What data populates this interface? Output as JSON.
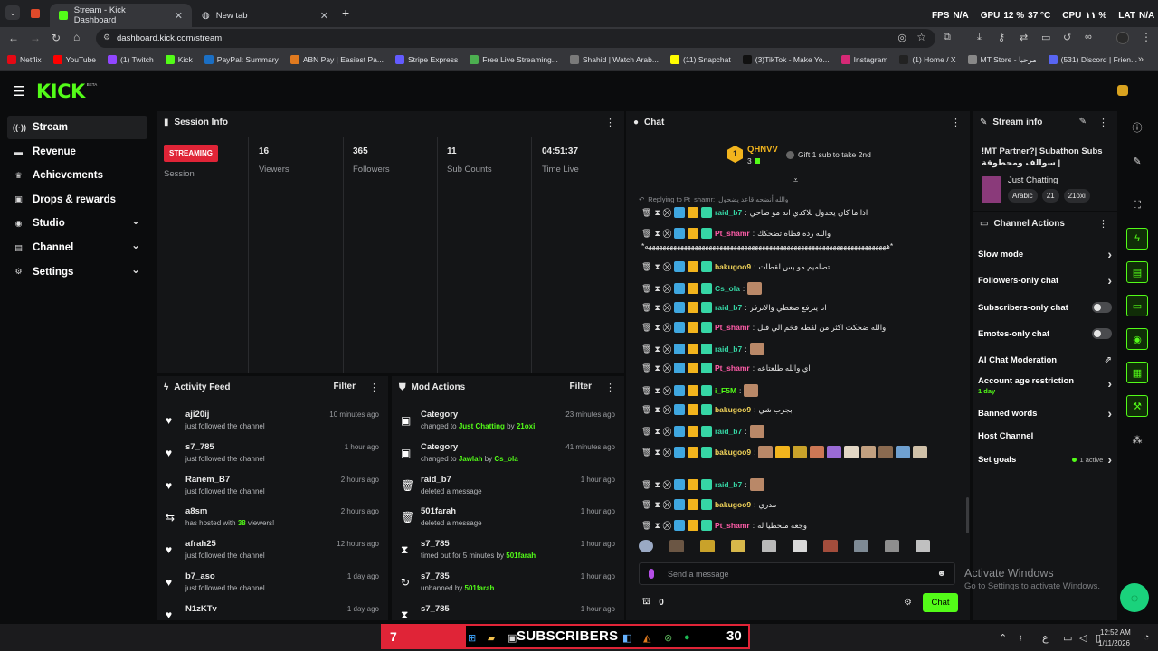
{
  "browser": {
    "tabs": [
      {
        "label": "Stream - Kick Dashboard",
        "active": true
      },
      {
        "label": "New tab",
        "active": false
      }
    ],
    "url": "dashboard.kick.com/stream",
    "overlay": {
      "fps_label": "FPS",
      "fps_value": "N/A",
      "gpu_label": "GPU",
      "gpu_value": "12 %",
      "gpu_temp": "37 °C",
      "cpu_label": "CPU",
      "cpu_value": "١١ %",
      "lat_label": "LAT",
      "lat_value": "N/A"
    },
    "bookmarks": [
      {
        "label": "Netflix",
        "color": "#e50914"
      },
      {
        "label": "YouTube",
        "color": "#ff0000"
      },
      {
        "label": "(1) Twitch",
        "color": "#9146ff"
      },
      {
        "label": "Kick",
        "color": "#53fc18"
      },
      {
        "label": "PayPal: Summary",
        "color": "#1b6fc4"
      },
      {
        "label": "ABN Pay | Easiest Pa...",
        "color": "#e07a1f"
      },
      {
        "label": "Stripe Express",
        "color": "#635bff"
      },
      {
        "label": "Free Live Streaming...",
        "color": "#4caf50"
      },
      {
        "label": "Shahid | Watch Arab...",
        "color": "#7a7a7a"
      },
      {
        "label": "(11) Snapchat",
        "color": "#fffc00"
      },
      {
        "label": "(3)TikTok - Make Yo...",
        "color": "#111111"
      },
      {
        "label": "Instagram",
        "color": "#d62976"
      },
      {
        "label": "(1) Home / X",
        "color": "#222222"
      },
      {
        "label": "MT Store - مرحبا",
        "color": "#888888"
      },
      {
        "label": "(531) Discord | Frien...",
        "color": "#5865f2"
      }
    ]
  },
  "brand": {
    "logo": "KICK",
    "beta": "BETA"
  },
  "nav": [
    {
      "label": "Stream",
      "icon": "stream-icon",
      "selected": true,
      "expandable": false
    },
    {
      "label": "Revenue",
      "icon": "revenue-icon",
      "selected": false,
      "expandable": false
    },
    {
      "label": "Achievements",
      "icon": "trophy-icon",
      "selected": false,
      "expandable": false
    },
    {
      "label": "Drops & rewards",
      "icon": "gift-icon",
      "selected": false,
      "expandable": false
    },
    {
      "label": "Studio",
      "icon": "studio-icon",
      "selected": false,
      "expandable": true
    },
    {
      "label": "Channel",
      "icon": "channel-icon",
      "selected": false,
      "expandable": true
    },
    {
      "label": "Settings",
      "icon": "settings-icon",
      "selected": false,
      "expandable": true
    }
  ],
  "session": {
    "title": "Session Info",
    "status_badge": "STREAMING",
    "session_label": "Session",
    "stats": [
      {
        "value": "16",
        "label": "Viewers"
      },
      {
        "value": "365",
        "label": "Followers"
      },
      {
        "value": "11",
        "label": "Sub Counts"
      },
      {
        "value": "04:51:37",
        "label": "Time Live"
      }
    ]
  },
  "activity": {
    "title": "Activity Feed",
    "filter": "Filter",
    "items": [
      {
        "name": "aji20ij",
        "desc": "just followed the channel",
        "time": "10 minutes ago",
        "icon": "heart-icon"
      },
      {
        "name": "s7_785",
        "desc": "just followed the channel",
        "time": "1 hour ago",
        "icon": "heart-icon"
      },
      {
        "name": "Ranem_B7",
        "desc": "just followed the channel",
        "time": "2 hours ago",
        "icon": "heart-icon"
      },
      {
        "name": "a8sm",
        "desc_pre": "has hosted with ",
        "desc_hl": "38",
        "desc_post": " viewers!",
        "time": "2 hours ago",
        "icon": "host-icon"
      },
      {
        "name": "afrah25",
        "desc": "just followed the channel",
        "time": "12 hours ago",
        "icon": "heart-icon"
      },
      {
        "name": "b7_aso",
        "desc": "just followed the channel",
        "time": "1 day ago",
        "icon": "heart-icon"
      },
      {
        "name": "N1zKTv",
        "desc": "",
        "time": "1 day ago",
        "icon": "heart-icon"
      }
    ]
  },
  "mod": {
    "title": "Mod Actions",
    "filter": "Filter",
    "items": [
      {
        "name": "Category",
        "pre": "changed to ",
        "hl": "Just Chatting",
        "mid": " by ",
        "hl2": "21oxi",
        "time": "23 minutes ago",
        "icon": "category-icon"
      },
      {
        "name": "Category",
        "pre": "changed to ",
        "hl": "Jawlah",
        "mid": " by ",
        "hl2": "Cs_ola",
        "time": "41 minutes ago",
        "icon": "category-icon"
      },
      {
        "name": "raid_b7",
        "pre": "deleted a message",
        "hl": "",
        "mid": "",
        "hl2": "",
        "time": "1 hour ago",
        "icon": "trash-icon"
      },
      {
        "name": "501farah",
        "pre": "deleted a message",
        "hl": "",
        "mid": "",
        "hl2": "",
        "time": "1 hour ago",
        "icon": "trash-icon"
      },
      {
        "name": "s7_785",
        "pre": "timed out for 5 minutes by ",
        "hl": "501farah",
        "mid": "",
        "hl2": "",
        "time": "1 hour ago",
        "icon": "hourglass-icon"
      },
      {
        "name": "s7_785",
        "pre": "unbanned by ",
        "hl": "501farah",
        "mid": "",
        "hl2": "",
        "time": "1 hour ago",
        "icon": "unban-icon"
      },
      {
        "name": "s7_785",
        "pre": "",
        "hl": "",
        "mid": "",
        "hl2": "",
        "time": "1 hour ago",
        "icon": "hourglass-icon"
      }
    ]
  },
  "chat": {
    "title": "Chat",
    "top_gifter": {
      "rank": "1",
      "name": "QHNVV",
      "count": "3"
    },
    "gift_cta": "Gift 1 sub to take 2nd",
    "reply_to": "Replying to Pt_shamr:",
    "reply_snippet": "والله أنضحه قاعد يضحول",
    "messages": [
      {
        "user": "raid_b7",
        "color": "#36d6a5",
        "text": "اذا ما كان يجدول تلاكدي انه مو صاحي",
        "emotes": 0
      },
      {
        "user": "Pt_shamr",
        "color": "#ff5ca8",
        "text": "والله رده قطاه تضحكك",
        "emotes": 0
      },
      {
        "user": "",
        "color": "#ffffff",
        "text": "*ههههههههههههههههههههههههههههههههههههههههههههههههههههههههههههههههههههه*",
        "emotes": 0
      },
      {
        "user": "bakugoo9",
        "color": "#f2d45a",
        "text": "تصاميم مو بس لقطات",
        "emotes": 0
      },
      {
        "user": "Cs_ola",
        "color": "#36d6a5",
        "text": "",
        "emotes": 1
      },
      {
        "user": "raid_b7",
        "color": "#36d6a5",
        "text": "انا يترفع ضغطي والاترفز",
        "emotes": 0
      },
      {
        "user": "Pt_shamr",
        "color": "#ff5ca8",
        "text": "والله ضحكت اكثر من لقطه فخم الي قبل",
        "emotes": 0
      },
      {
        "user": "raid_b7",
        "color": "#36d6a5",
        "text": "",
        "emotes": 1
      },
      {
        "user": "Pt_shamr",
        "color": "#ff5ca8",
        "text": "اي والله طلعتاعه",
        "emotes": 0
      },
      {
        "user": "i_F5M",
        "color": "#53fc18",
        "text": "",
        "emotes": 1
      },
      {
        "user": "bakugoo9",
        "color": "#f2d45a",
        "text": "بجرب شي",
        "emotes": 0
      },
      {
        "user": "raid_b7",
        "color": "#36d6a5",
        "text": "",
        "emotes": 1
      },
      {
        "user": "bakugoo9",
        "color": "#f2d45a",
        "text": "",
        "emotes": 10
      },
      {
        "user": "raid_b7",
        "color": "#36d6a5",
        "text": "",
        "emotes": 1
      },
      {
        "user": "bakugoo9",
        "color": "#f2d45a",
        "text": "مدري",
        "emotes": 0
      },
      {
        "user": "Pt_shamr",
        "color": "#ff5ca8",
        "text": "وجعه ملحطيا له",
        "emotes": 0
      }
    ],
    "input_placeholder": "Send a message",
    "points": "0",
    "send_label": "Chat"
  },
  "stream_info": {
    "title": "Stream info",
    "stream_title": "!MT Partner?| Subathon Subs سوالف ومحطوقة |",
    "category": "Just Chatting",
    "tags": [
      "Arabic",
      "21",
      "21oxi"
    ]
  },
  "channel_actions": {
    "title": "Channel Actions",
    "items": [
      {
        "label": "Slow mode",
        "kind": "chevron",
        "sub": ""
      },
      {
        "label": "Followers-only chat",
        "kind": "chevron",
        "sub": ""
      },
      {
        "label": "Subscribers-only chat",
        "kind": "toggle",
        "sub": ""
      },
      {
        "label": "Emotes-only chat",
        "kind": "toggle",
        "sub": ""
      },
      {
        "label": "AI Chat Moderation",
        "kind": "link",
        "sub": ""
      },
      {
        "label": "Account age restriction",
        "kind": "chevron",
        "sub": "1 day"
      },
      {
        "label": "Banned words",
        "kind": "chevron",
        "sub": ""
      },
      {
        "label": "Host Channel",
        "kind": "none",
        "sub": ""
      },
      {
        "label": "Set goals",
        "kind": "chevron",
        "sub": "",
        "status": "1 active"
      }
    ]
  },
  "watermark": {
    "line1": "Activate Windows",
    "line2": "Go to Settings to activate Windows."
  },
  "taskbar": {
    "left_badge": "7",
    "subs_label": "SUBSCRIBERS",
    "subs_count": "30",
    "lang": "ع",
    "time": "12:52 AM",
    "date": "1/11/2026"
  },
  "colors": {
    "accent": "#53fc18",
    "live": "#e02437",
    "bg": "#0b0c0d",
    "panel": "#141517"
  }
}
